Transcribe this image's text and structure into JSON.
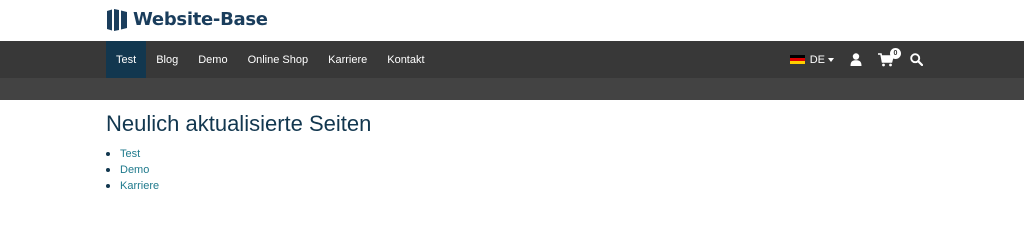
{
  "brand": {
    "name": "Website-Base",
    "color": "#1a3d5c"
  },
  "nav": {
    "items": [
      {
        "label": "Test",
        "active": true
      },
      {
        "label": "Blog",
        "active": false
      },
      {
        "label": "Demo",
        "active": false
      },
      {
        "label": "Online Shop",
        "active": false
      },
      {
        "label": "Karriere",
        "active": false
      },
      {
        "label": "Kontakt",
        "active": false
      }
    ],
    "language": {
      "code": "DE",
      "flag": "germany-flag-icon"
    },
    "account_icon": "user-icon",
    "cart": {
      "icon": "shopping-cart-icon",
      "count": "0"
    },
    "search_icon": "search-icon"
  },
  "main": {
    "title": "Neulich aktualisierte Seiten",
    "pages": [
      {
        "label": "Test"
      },
      {
        "label": "Demo"
      },
      {
        "label": "Karriere"
      }
    ]
  },
  "colors": {
    "navbar": "#383838",
    "subbar": "#434343",
    "active_tab": "#12374f",
    "link": "#1f7a8c"
  }
}
